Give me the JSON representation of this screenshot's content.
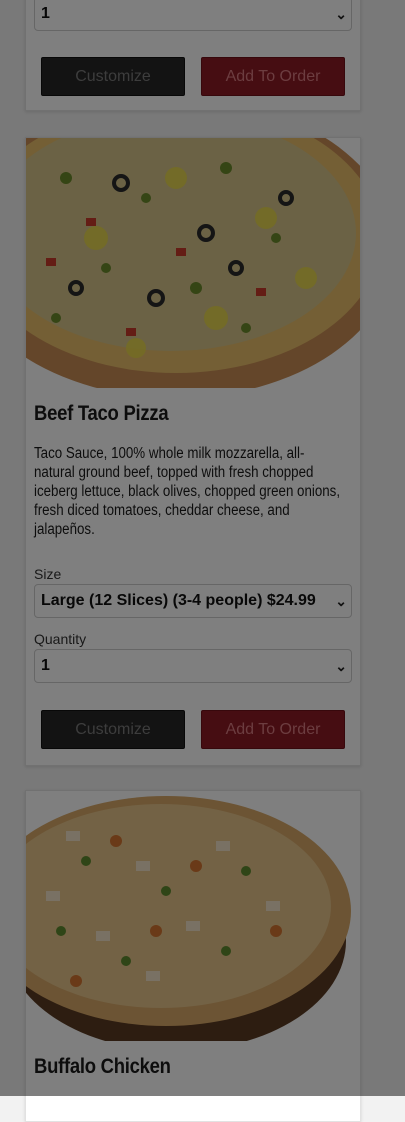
{
  "items": [
    {
      "quantity_value": "1",
      "customize_label": "Customize",
      "add_label": "Add To Order"
    },
    {
      "title": "Beef Taco Pizza",
      "description": "Taco Sauce, 100% whole milk mozzarella, all-natural ground beef, topped with fresh chopped iceberg lettuce, black olives, chopped green onions, fresh diced tomatoes, cheddar cheese, and jalapeños.",
      "size_label": "Size",
      "size_value": "Large (12 Slices) (3-4 people) $24.99",
      "quantity_label": "Quantity",
      "quantity_value": "1",
      "customize_label": "Customize",
      "add_label": "Add To Order"
    },
    {
      "title": "Buffalo Chicken"
    }
  ],
  "icons": {
    "select_arrow": "chevron-down-icon"
  },
  "colors": {
    "customize_button": "#262626",
    "add_button": "#8c1a24",
    "page_overlay": "rgba(0,0,0,0.5)"
  }
}
